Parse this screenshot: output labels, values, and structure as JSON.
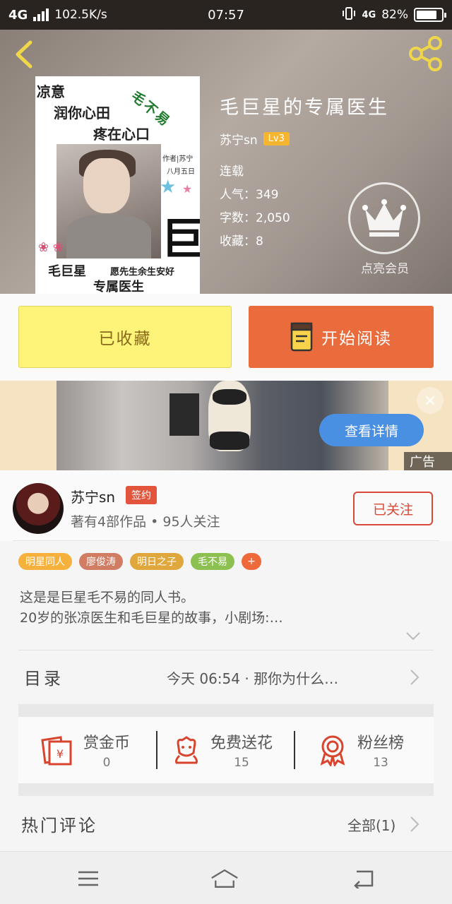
{
  "status_bar": {
    "network": "4G",
    "speed": "102.5K/s",
    "time": "07:57",
    "network_right": "4G",
    "battery": "82%",
    "battery_level": 0.82
  },
  "book": {
    "title": "毛巨星的专属医生",
    "author": "苏宁sn",
    "level": "Lv3",
    "status": "连载",
    "popularity": "人气：349",
    "word_count": "字数：2,050",
    "favorites": "收藏：8",
    "vip_label": "点亮会员"
  },
  "cover": {
    "line1": "凉意",
    "line2": "润你心田",
    "line3": "疼在心口",
    "green_text": "毛不易",
    "author_tag": "作者|苏宁",
    "date_tag": "八月五日",
    "big_char": "巨",
    "name1": "毛巨星",
    "name2": "专属医生",
    "slogan": "愿先生余生安好"
  },
  "actions": {
    "favorited": "已收藏",
    "start_reading": "开始阅读"
  },
  "ad": {
    "details": "查看详情",
    "tag": "广告",
    "close": "×"
  },
  "author_section": {
    "name": "苏宁sn",
    "badge": "签约",
    "summary": "著有4部作品 • 95人关注",
    "follow": "已关注"
  },
  "tags": [
    {
      "label": "明星同人",
      "color": "#f5b13b"
    },
    {
      "label": "廖俊涛",
      "color": "#d07d63"
    },
    {
      "label": "明日之子",
      "color": "#e0a73d"
    },
    {
      "label": "毛不易",
      "color": "#8cc152"
    },
    {
      "label": "+",
      "color": "#ee6a3a"
    }
  ],
  "intro": {
    "line1": "这是是巨星毛不易的同人书。",
    "line2": "20岁的张凉医生和毛巨星的故事，小剧场:…"
  },
  "toc": {
    "label": "目录",
    "latest": "今天 06:54 · 那你为什么…"
  },
  "rewards": [
    {
      "label": "赏金币",
      "count": "0",
      "icon": "red-envelope-icon"
    },
    {
      "label": "免费送花",
      "count": "15",
      "icon": "flower-icon"
    },
    {
      "label": "粉丝榜",
      "count": "13",
      "icon": "medal-icon"
    }
  ],
  "comments": {
    "title": "热门评论",
    "all": "全部(1)"
  },
  "nav": {
    "menu": "menu-icon",
    "home": "home-icon",
    "back": "back-icon"
  },
  "colors": {
    "accent_orange": "#ea6b3b",
    "fav_yellow": "#fef47a",
    "follow_red": "#d64a37",
    "ad_button": "#4a90e2"
  }
}
